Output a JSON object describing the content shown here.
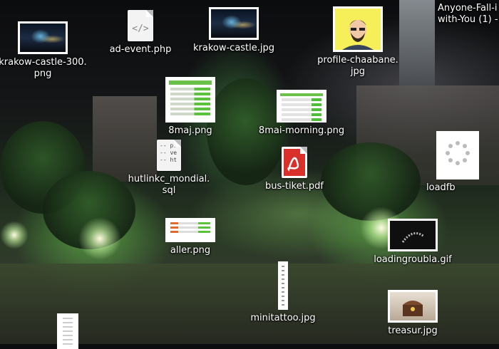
{
  "desktop": {
    "icons": [
      {
        "id": "krakow300",
        "label": "krakow-castle-300.\npng",
        "type": "image"
      },
      {
        "id": "adevent",
        "label": "ad-event.php",
        "type": "code"
      },
      {
        "id": "krakowjpg",
        "label": "krakow-castle.jpg",
        "type": "image"
      },
      {
        "id": "profile",
        "label": "profile-chaabane.\njpg",
        "type": "image"
      },
      {
        "id": "anyone",
        "label": "Anyone-Fall-i\nwith-You (1) -",
        "type": "file"
      },
      {
        "id": "8maj",
        "label": "8maj.png",
        "type": "image"
      },
      {
        "id": "8maimorning",
        "label": "8mai-morning.png",
        "type": "image"
      },
      {
        "id": "hutlinkc",
        "label": "hutlinkc_mondial.\nsql",
        "type": "text"
      },
      {
        "id": "busticket",
        "label": "bus-tiket.pdf",
        "type": "pdf"
      },
      {
        "id": "loadfb",
        "label": "loadfb",
        "type": "image"
      },
      {
        "id": "aller",
        "label": "aller.png",
        "type": "image"
      },
      {
        "id": "loadingroubla",
        "label": "loadingroubla.gif",
        "type": "image"
      },
      {
        "id": "minitattoo",
        "label": "minitattoo.jpg",
        "type": "image"
      },
      {
        "id": "treasur",
        "label": "treasur.jpg",
        "type": "image"
      }
    ]
  },
  "sql_preview": "-- pr\n-- ve\n-- ht",
  "colors": {
    "label": "#ffffff",
    "accent": "#5cc23d",
    "pdf": "#d9302c"
  }
}
